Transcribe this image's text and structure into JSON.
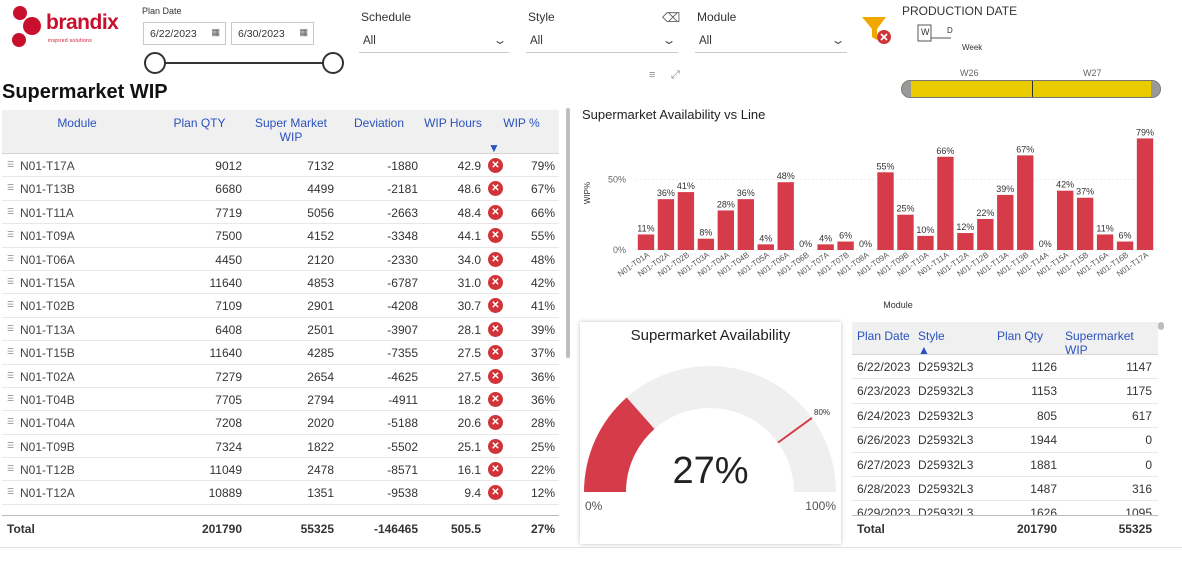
{
  "brand": {
    "name": "brandix",
    "tagline": "inspired solutions",
    "color": "#c8102e"
  },
  "filters": {
    "plan_date_label": "Plan Date",
    "date_from": "6/22/2023",
    "date_to": "6/30/2023",
    "schedule_label": "Schedule",
    "schedule_value": "All",
    "style_label": "Style",
    "style_value": "All",
    "module_label": "Module",
    "module_value": "All",
    "production_date_label": "PRODUCTION DATE",
    "granularity_w": "W",
    "granularity_d": "D",
    "granularity_caption": "Week",
    "timeline_weeks": [
      "W26",
      "W27"
    ],
    "timeline_color": "#e9cb00"
  },
  "page": {
    "title": "Supermarket WIP"
  },
  "wip_table": {
    "headers": {
      "module": "Module",
      "plan_qty": "Plan QTY",
      "super_market_wip": "Super Market WIP",
      "deviation": "Deviation",
      "wip_hours": "WIP Hours",
      "wip_pct": "WIP %"
    },
    "rows": [
      {
        "module": "N01-T17A",
        "plan_qty": "9012",
        "wip": "7132",
        "deviation": "-1880",
        "hours": "42.9",
        "pct": "79%"
      },
      {
        "module": "N01-T13B",
        "plan_qty": "6680",
        "wip": "4499",
        "deviation": "-2181",
        "hours": "48.6",
        "pct": "67%"
      },
      {
        "module": "N01-T11A",
        "plan_qty": "7719",
        "wip": "5056",
        "deviation": "-2663",
        "hours": "48.4",
        "pct": "66%"
      },
      {
        "module": "N01-T09A",
        "plan_qty": "7500",
        "wip": "4152",
        "deviation": "-3348",
        "hours": "44.1",
        "pct": "55%"
      },
      {
        "module": "N01-T06A",
        "plan_qty": "4450",
        "wip": "2120",
        "deviation": "-2330",
        "hours": "34.0",
        "pct": "48%"
      },
      {
        "module": "N01-T15A",
        "plan_qty": "11640",
        "wip": "4853",
        "deviation": "-6787",
        "hours": "31.0",
        "pct": "42%"
      },
      {
        "module": "N01-T02B",
        "plan_qty": "7109",
        "wip": "2901",
        "deviation": "-4208",
        "hours": "30.7",
        "pct": "41%"
      },
      {
        "module": "N01-T13A",
        "plan_qty": "6408",
        "wip": "2501",
        "deviation": "-3907",
        "hours": "28.1",
        "pct": "39%"
      },
      {
        "module": "N01-T15B",
        "plan_qty": "11640",
        "wip": "4285",
        "deviation": "-7355",
        "hours": "27.5",
        "pct": "37%"
      },
      {
        "module": "N01-T02A",
        "plan_qty": "7279",
        "wip": "2654",
        "deviation": "-4625",
        "hours": "27.5",
        "pct": "36%"
      },
      {
        "module": "N01-T04B",
        "plan_qty": "7705",
        "wip": "2794",
        "deviation": "-4911",
        "hours": "18.2",
        "pct": "36%"
      },
      {
        "module": "N01-T04A",
        "plan_qty": "7208",
        "wip": "2020",
        "deviation": "-5188",
        "hours": "20.6",
        "pct": "28%"
      },
      {
        "module": "N01-T09B",
        "plan_qty": "7324",
        "wip": "1822",
        "deviation": "-5502",
        "hours": "25.1",
        "pct": "25%"
      },
      {
        "module": "N01-T12B",
        "plan_qty": "11049",
        "wip": "2478",
        "deviation": "-8571",
        "hours": "16.1",
        "pct": "22%"
      },
      {
        "module": "N01-T12A",
        "plan_qty": "10889",
        "wip": "1351",
        "deviation": "-9538",
        "hours": "9.4",
        "pct": "12%"
      }
    ],
    "total": {
      "label": "Total",
      "plan_qty": "201790",
      "wip": "55325",
      "deviation": "-146465",
      "hours": "505.5",
      "pct": "27%"
    },
    "status_color": "#d13438"
  },
  "availability_chart": {
    "title": "Supermarket Availability vs Line",
    "ylabel": "WIP%",
    "xlabel": "Module",
    "bar_color": "#d63b4a",
    "chart_data": {
      "type": "bar",
      "categories": [
        "N01-T01A",
        "N01-T02A",
        "N01-T02B",
        "N01-T03A",
        "N01-T04A",
        "N01-T04B",
        "N01-T05A",
        "N01-T06A",
        "N01-T06B",
        "N01-T07A",
        "N01-T07B",
        "N01-T08A",
        "N01-T09A",
        "N01-T09B",
        "N01-T10A",
        "N01-T11A",
        "N01-T12A",
        "N01-T12B",
        "N01-T13A",
        "N01-T13B",
        "N01-T14A",
        "N01-T15A",
        "N01-T15B",
        "N01-T16A",
        "N01-T16B",
        "N01-T17A"
      ],
      "values": [
        11,
        36,
        41,
        8,
        28,
        36,
        4,
        48,
        0,
        4,
        6,
        0,
        55,
        25,
        10,
        66,
        12,
        22,
        39,
        67,
        0,
        42,
        37,
        11,
        6,
        79
      ],
      "value_labels": [
        "11%",
        "36%",
        "41%",
        "8%",
        "28%",
        "36%",
        "4%",
        "48%",
        "0%",
        "4%",
        "6%",
        "0%",
        "55%",
        "25%",
        "10%",
        "66%",
        "12%",
        "22%",
        "39%",
        "67%",
        "0%",
        "42%",
        "37%",
        "11%",
        "6%",
        "79%"
      ],
      "ylim": [
        0,
        80
      ],
      "yticks": [
        "0%",
        "50%"
      ]
    }
  },
  "gauge": {
    "title": "Supermarket Availability",
    "value": 27,
    "value_label": "27%",
    "min_label": "0%",
    "max_label": "100%",
    "target": 80,
    "target_label": "80%",
    "fill_color": "#d63b4a",
    "track_color": "#efefef"
  },
  "detail_table": {
    "headers": {
      "plan_date": "Plan Date",
      "style": "Style",
      "plan_qty": "Plan Qty",
      "supermarket_wip": "Supermarket WIP"
    },
    "rows": [
      {
        "date": "6/22/2023",
        "style": "D25932L3",
        "plan_qty": "1126",
        "wip": "1147"
      },
      {
        "date": "6/23/2023",
        "style": "D25932L3",
        "plan_qty": "1153",
        "wip": "1175"
      },
      {
        "date": "6/24/2023",
        "style": "D25932L3",
        "plan_qty": "805",
        "wip": "617"
      },
      {
        "date": "6/26/2023",
        "style": "D25932L3",
        "plan_qty": "1944",
        "wip": "0"
      },
      {
        "date": "6/27/2023",
        "style": "D25932L3",
        "plan_qty": "1881",
        "wip": "0"
      },
      {
        "date": "6/28/2023",
        "style": "D25932L3",
        "plan_qty": "1487",
        "wip": "316"
      },
      {
        "date": "6/29/2023",
        "style": "D25932L3",
        "plan_qty": "1626",
        "wip": "1095"
      }
    ],
    "total": {
      "label": "Total",
      "plan_qty": "201790",
      "wip": "55325"
    }
  }
}
